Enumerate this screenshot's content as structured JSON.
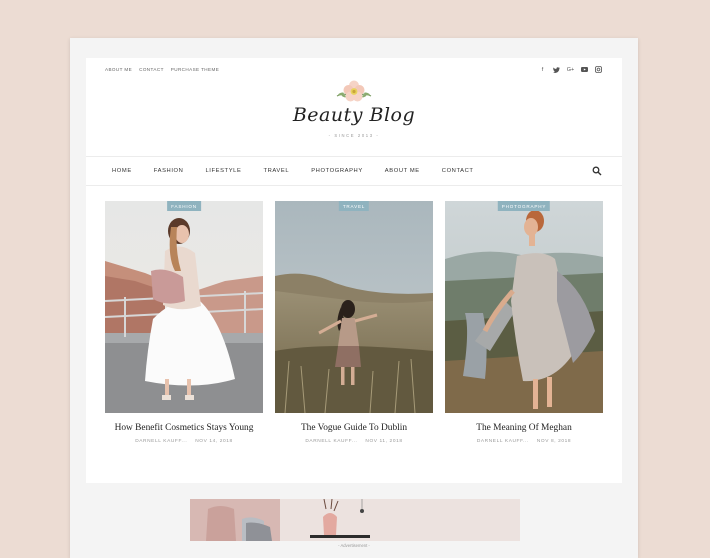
{
  "topbar": {
    "links": [
      "ABOUT ME",
      "CONTACT",
      "PURCHASE THEME"
    ],
    "social_icons": [
      "facebook-icon",
      "twitter-icon",
      "google-plus-icon",
      "youtube-icon",
      "instagram-icon"
    ]
  },
  "logo": {
    "text": "Beauty Blog",
    "tagline": "- SINCE 2013 -"
  },
  "nav": {
    "items": [
      "HOME",
      "FASHION",
      "LIFESTYLE",
      "TRAVEL",
      "PHOTOGRAPHY",
      "ABOUT ME",
      "CONTACT"
    ],
    "search_icon": "search-icon"
  },
  "posts": [
    {
      "category": "FASHION",
      "title": "How Benefit Cosmetics Stays Young",
      "author": "DARNELL KAUFF...",
      "date": "NOV 14, 2018"
    },
    {
      "category": "TRAVEL",
      "title": "The Vogue Guide To Dublin",
      "author": "DARNELL KAUFF...",
      "date": "NOV 11, 2018"
    },
    {
      "category": "PHOTOGRAPHY",
      "title": "The Meaning Of Meghan",
      "author": "DARNELL KAUFF...",
      "date": "NOV 8, 2018"
    }
  ],
  "ad": {
    "label": "- Advertisement -"
  },
  "colors": {
    "badge": "#8fb3bf",
    "background": "#ecdcd3"
  }
}
